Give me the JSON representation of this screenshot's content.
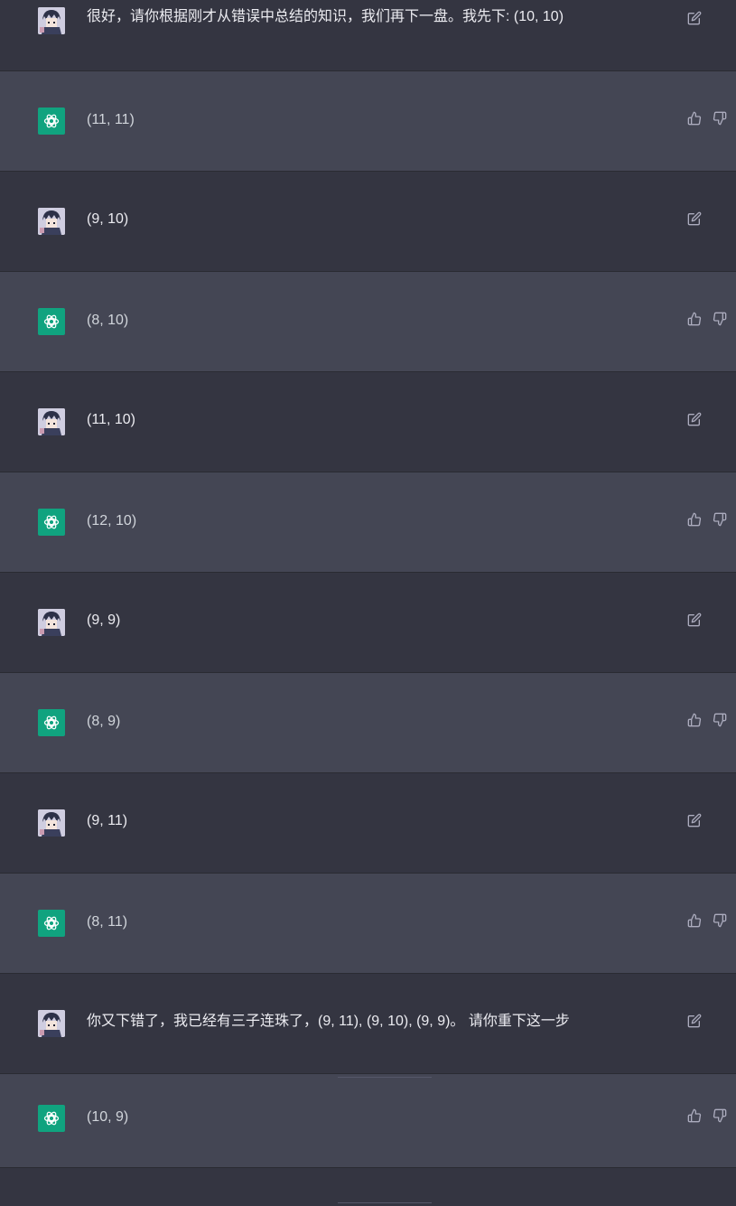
{
  "messages": [
    {
      "role": "user",
      "text": "很好，请你根据刚才从错误中总结的知识，我们再下一盘。我先下: (10, 10)"
    },
    {
      "role": "assistant",
      "text": "(11, 11)"
    },
    {
      "role": "user",
      "text": "(9, 10)"
    },
    {
      "role": "assistant",
      "text": "(8, 10)"
    },
    {
      "role": "user",
      "text": "(11, 10)"
    },
    {
      "role": "assistant",
      "text": "(12, 10)"
    },
    {
      "role": "user",
      "text": "(9, 9)"
    },
    {
      "role": "assistant",
      "text": "(8, 9)"
    },
    {
      "role": "user",
      "text": "(9, 11)"
    },
    {
      "role": "assistant",
      "text": "(8, 11)"
    },
    {
      "role": "user",
      "text": "你又下错了，我已经有三子连珠了，(9, 11), (9, 10), (9, 9)。 请你重下这一步"
    },
    {
      "role": "assistant",
      "text": "(10, 9)"
    }
  ],
  "icons": {
    "edit": "edit-icon",
    "thumbs_up": "thumbs-up-icon",
    "thumbs_down": "thumbs-down-icon",
    "user_avatar": "user-avatar",
    "assistant_avatar": "openai-logo-icon"
  },
  "colors": {
    "user_bg": "#343541",
    "assistant_bg": "#444654",
    "assistant_avatar_bg": "#10a37f",
    "icon": "#acacbe"
  }
}
